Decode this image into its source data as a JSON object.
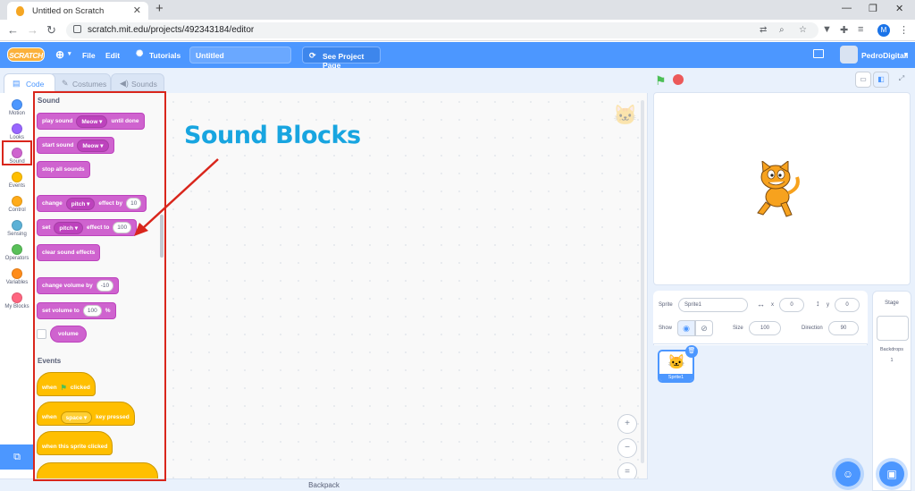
{
  "browser": {
    "tab_title": "Untitled on Scratch",
    "tab_close": "✕",
    "new_tab": "+",
    "url": "scratch.mit.edu/projects/492343184/editor",
    "profile_initial": "M",
    "window_min": "—",
    "window_max": "❐",
    "window_close": "✕"
  },
  "menubar": {
    "logo": "SCRATCH",
    "file": "File",
    "edit": "Edit",
    "tutorials": "Tutorials",
    "project_title": "Untitled",
    "see_project": "See Project Page",
    "username": "PedroDigitall"
  },
  "editor_tabs": {
    "code": "Code",
    "costumes": "Costumes",
    "sounds": "Sounds"
  },
  "categories": [
    {
      "label": "Motion",
      "color": "#4c97ff"
    },
    {
      "label": "Looks",
      "color": "#9966ff"
    },
    {
      "label": "Sound",
      "color": "#cf63cf"
    },
    {
      "label": "Events",
      "color": "#ffbf00"
    },
    {
      "label": "Control",
      "color": "#ffab19"
    },
    {
      "label": "Sensing",
      "color": "#5cb1d6"
    },
    {
      "label": "Operators",
      "color": "#59c059"
    },
    {
      "label": "Variables",
      "color": "#ff8c1a"
    },
    {
      "label": "My Blocks",
      "color": "#ff6680"
    }
  ],
  "palette": {
    "sound_heading": "Sound",
    "events_heading": "Events",
    "blocks": {
      "play_sound": {
        "pre": "play sound",
        "menu": "Meow ▾",
        "post": "until done"
      },
      "start_sound": {
        "pre": "start sound",
        "menu": "Meow ▾"
      },
      "stop_all": {
        "pre": "stop all sounds"
      },
      "change_effect": {
        "pre": "change",
        "menu": "pitch ▾",
        "mid": "effect by",
        "value": "10"
      },
      "set_effect": {
        "pre": "set",
        "menu": "pitch ▾",
        "mid": "effect to",
        "value": "100"
      },
      "clear_effects": {
        "pre": "clear sound effects"
      },
      "change_volume": {
        "pre": "change volume by",
        "value": "-10"
      },
      "set_volume": {
        "pre": "set volume to",
        "value": "100",
        "post": "%"
      },
      "volume": {
        "pre": "volume"
      },
      "when_flag": {
        "pre": "when",
        "post": "clicked"
      },
      "when_key": {
        "pre": "when",
        "menu": "space ▾",
        "post": "key pressed"
      },
      "when_sprite": {
        "pre": "when this sprite clicked"
      }
    }
  },
  "annotation": {
    "text": "Sound Blocks",
    "color": "#18a5e0",
    "highlight_color": "#d9261c"
  },
  "workspace": {
    "zoom_in": "+",
    "zoom_out": "−",
    "zoom_reset": "="
  },
  "backpack": "Backpack",
  "sprite_info": {
    "sprite_label": "Sprite",
    "sprite_name": "Sprite1",
    "x_label": "x",
    "x_value": "0",
    "y_label": "y",
    "y_value": "0",
    "show_label": "Show",
    "size_label": "Size",
    "size_value": "100",
    "direction_label": "Direction",
    "direction_value": "90"
  },
  "sprite_tile": "Sprite1",
  "stage_pane": {
    "title": "Stage",
    "backdrops_label": "Backdrops",
    "backdrops_count": "1"
  }
}
